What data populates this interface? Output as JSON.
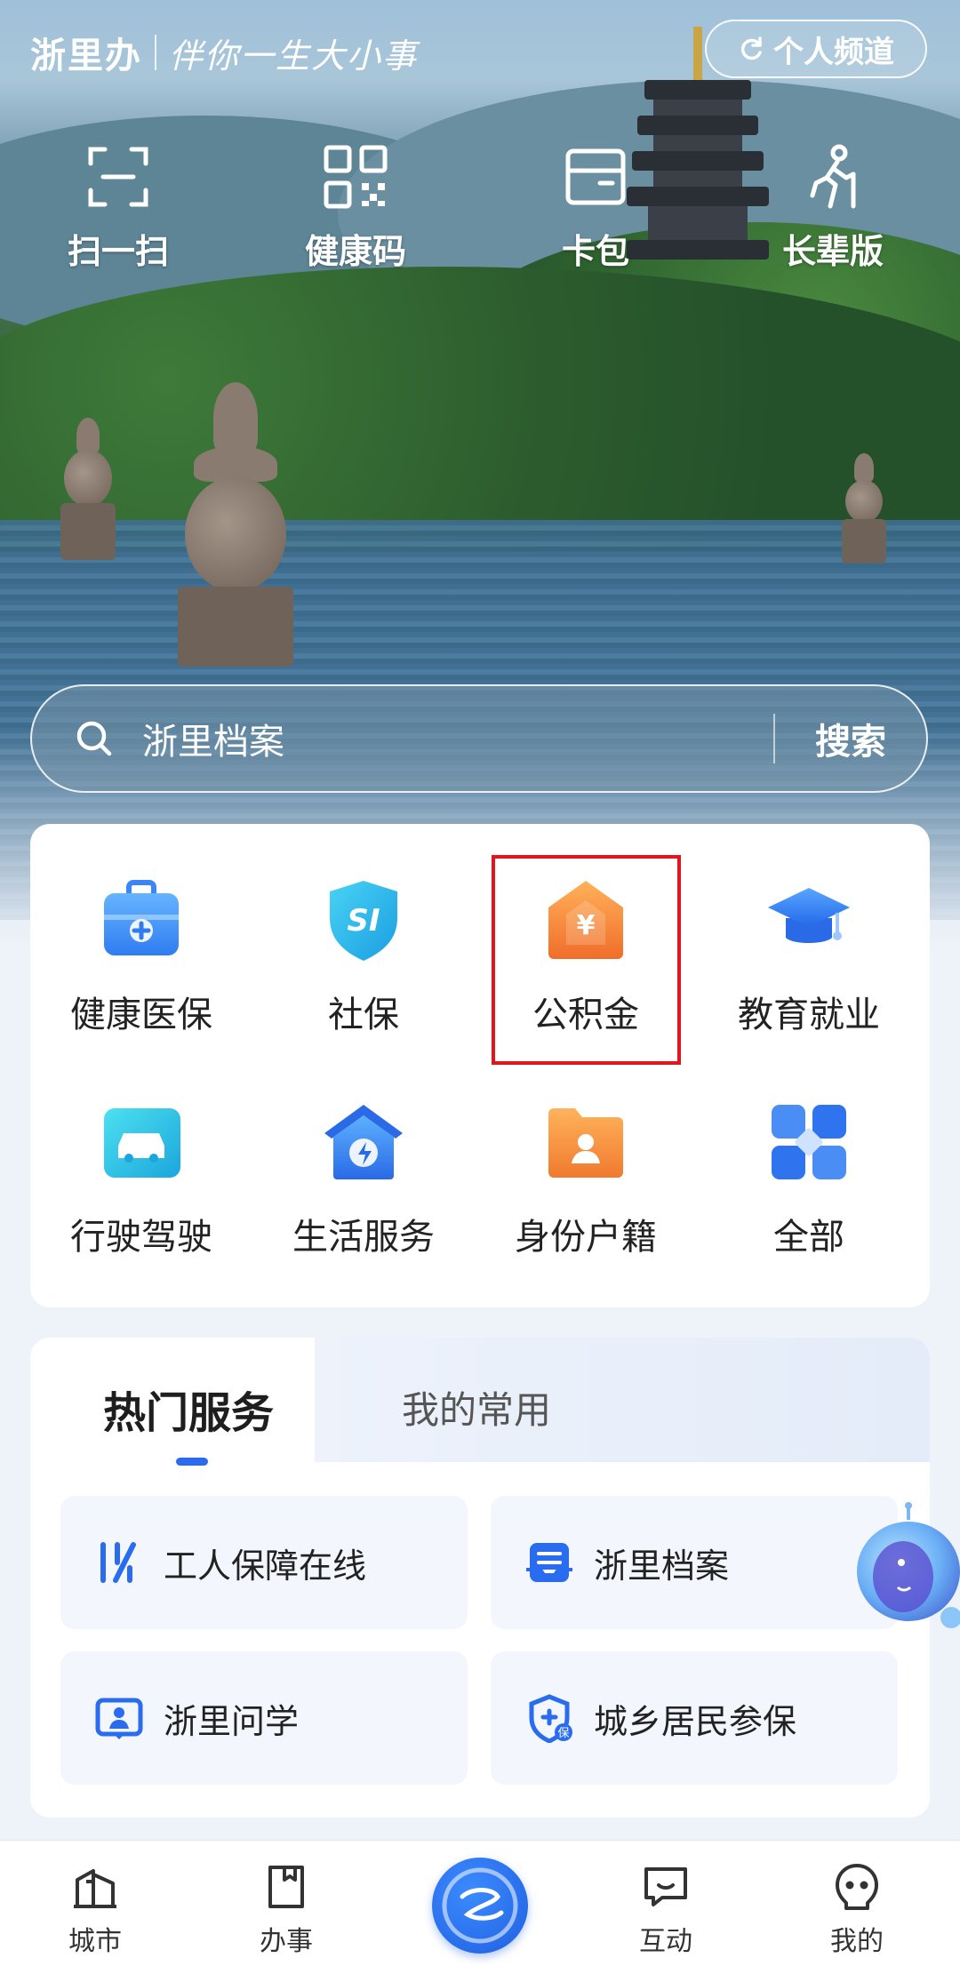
{
  "brand": {
    "name": "浙里办",
    "slogan": "伴你一生大小事"
  },
  "header": {
    "channel_label": "个人频道"
  },
  "quick_actions": [
    {
      "label": "扫一扫",
      "icon": "scan-icon"
    },
    {
      "label": "健康码",
      "icon": "qr-code-icon"
    },
    {
      "label": "卡包",
      "icon": "card-wallet-icon"
    },
    {
      "label": "长辈版",
      "icon": "elder-mode-icon"
    }
  ],
  "search": {
    "placeholder": "浙里档案",
    "button_label": "搜索"
  },
  "categories": [
    {
      "label": "健康医保",
      "icon": "medical-kit-icon"
    },
    {
      "label": "社保",
      "icon": "social-security-shield-icon"
    },
    {
      "label": "公积金",
      "icon": "housing-fund-icon"
    },
    {
      "label": "教育就业",
      "icon": "graduation-cap-icon"
    },
    {
      "label": "行驶驾驶",
      "icon": "car-icon"
    },
    {
      "label": "生活服务",
      "icon": "home-service-icon"
    },
    {
      "label": "身份户籍",
      "icon": "id-folder-icon"
    },
    {
      "label": "全部",
      "icon": "all-grid-icon"
    }
  ],
  "services": {
    "tabs": [
      {
        "label": "热门服务"
      },
      {
        "label": "我的常用"
      }
    ],
    "items": [
      {
        "label": "工人保障在线",
        "icon": "worker-protection-icon"
      },
      {
        "label": "浙里档案",
        "icon": "archive-icon"
      },
      {
        "label": "浙里问学",
        "icon": "study-icon"
      },
      {
        "label": "城乡居民参保",
        "icon": "insurance-shield-icon"
      }
    ]
  },
  "bottom_nav": [
    {
      "label": "城市",
      "icon": "city-icon"
    },
    {
      "label": "办事",
      "icon": "tasks-icon"
    },
    {
      "label": "",
      "icon": "home-logo-icon"
    },
    {
      "label": "互动",
      "icon": "chat-icon"
    },
    {
      "label": "我的",
      "icon": "profile-icon"
    }
  ],
  "colors": {
    "accent": "#2a6cf0",
    "highlight_border": "#e3141b",
    "housing_fund_orange": "#f4893a"
  }
}
